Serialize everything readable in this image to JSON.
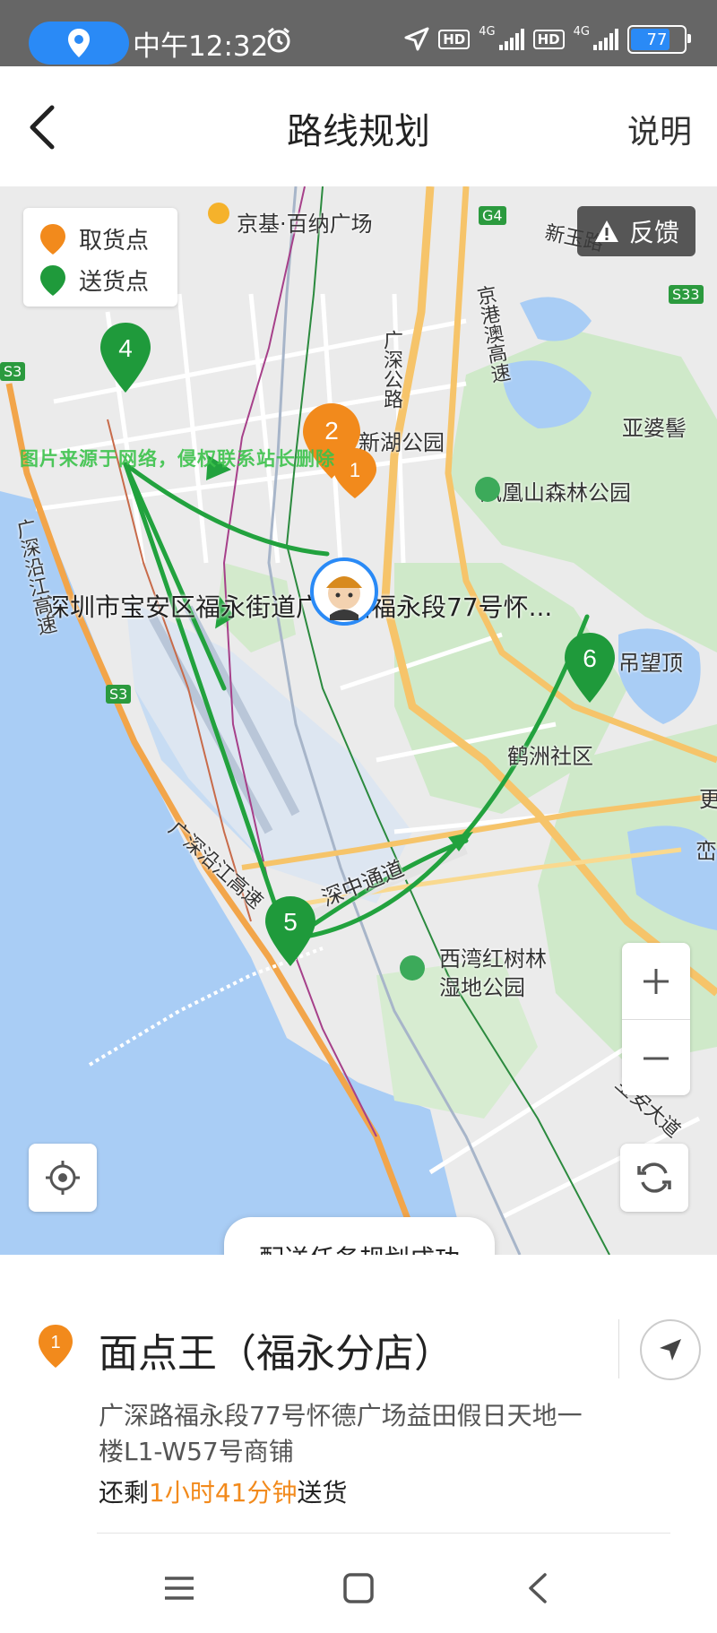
{
  "status_bar": {
    "time": "中午12:32",
    "network_1": "4G",
    "network_2": "4G",
    "hd_1": "HD",
    "hd_2": "HD",
    "battery": "77"
  },
  "header": {
    "title": "路线规划",
    "help": "说明"
  },
  "map": {
    "legend": {
      "pickup": "取货点",
      "delivery": "送货点"
    },
    "feedback": "反馈",
    "watermark": "图片来源于网络，侵权联系站长删除",
    "labels": {
      "mall": "京基·百纳广场",
      "xinyu_road": "新玉路",
      "g4": "G4",
      "s33": "S33",
      "s3_left": "S3",
      "s3_mid": "S3",
      "guangshen_road": "广深公路",
      "jinggangao": "京港澳高速",
      "xinhu_park": "新湖公园",
      "yaposhan": "亚婆髻",
      "fenghuang_park": "凤凰山森林公园",
      "address_overlay": "深圳市宝安区福永街道广深路福永段77号怀...",
      "diaowang": "吊望顶",
      "hezhou": "鹤洲社区",
      "guangshen_coastal_left": "广深沿江高速",
      "guangshen_coastal_mid": "广深沿江高速",
      "shenzhong": "深中通道",
      "xiwan_park_1": "西湾红树林",
      "xiwan_park_2": "湿地公园",
      "baoan_ave": "宝安大道",
      "edge_text_1": "更",
      "edge_text_2": "峦"
    },
    "markers": {
      "m1": "1",
      "m2": "2",
      "m4": "4",
      "m5": "5",
      "m6": "6"
    },
    "toast": "配送任务规划成功"
  },
  "card": {
    "stop_number": "1",
    "shop_name": "面点王（福永分店）",
    "address": "广深路福永段77号怀德广场益田假日天地一楼L1-W57号商铺",
    "eta_prefix": "还剩",
    "eta_time": "1小时41分钟",
    "eta_suffix": "送货"
  },
  "colors": {
    "pickup": "#f28a1c",
    "delivery": "#1f9a3b",
    "route": "#22a23e",
    "water": "#a9cdf5",
    "park": "#cfe9c9"
  }
}
